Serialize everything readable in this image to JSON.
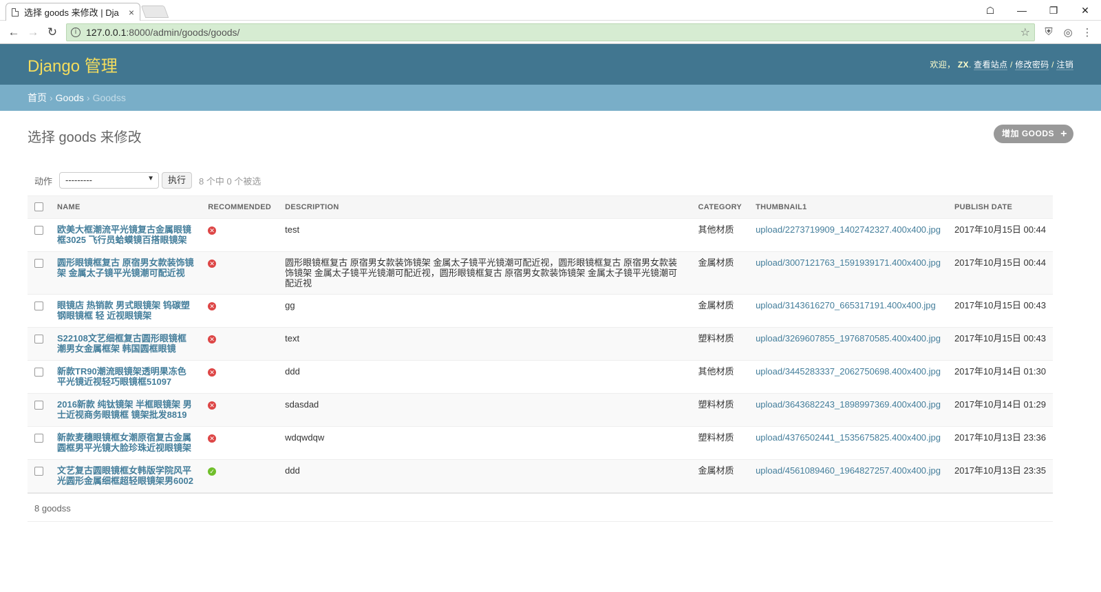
{
  "browser": {
    "tab_title": "选择 goods 来修改 | Dja",
    "tab_close": "×",
    "url_host": "127.0.0.1",
    "url_rest": ":8000/admin/goods/goods/",
    "controls": {
      "minimize": "—",
      "restore": "❐",
      "close": "✕",
      "back": "←",
      "forward": "→",
      "reload": "↻",
      "star": "☆",
      "menu": "⋮"
    }
  },
  "header": {
    "branding": "Django 管理",
    "welcome": "欢迎，",
    "username": "ZX",
    "period": ".",
    "view_site": "查看站点",
    "change_password": "修改密码",
    "logout": "注销",
    "sep": "/"
  },
  "breadcrumbs": {
    "home": "首页",
    "app": "Goods",
    "current": "Goodss",
    "sep": "›"
  },
  "page": {
    "title": "选择 goods 来修改",
    "add_button": "增加 GOODS",
    "plus": "+"
  },
  "actions": {
    "label": "动作",
    "selected_option": "---------",
    "go_button": "执行",
    "counter": "8 个中 0 个被选"
  },
  "table": {
    "headers": {
      "name": "NAME",
      "recommended": "RECOMMENDED",
      "description": "DESCRIPTION",
      "category": "CATEGORY",
      "thumbnail": "THUMBNAIL1",
      "publish_date": "PUBLISH DATE"
    },
    "rows": [
      {
        "name": "欧美大框潮流平光镜复古金属眼镜框3025 飞行员蛤蟆镜百搭眼镜架",
        "recommended": false,
        "description": "test",
        "category": "其他材质",
        "thumbnail": "upload/2273719909_1402742327.400x400.jpg",
        "date": "2017年10月15日 00:44"
      },
      {
        "name": "圆形眼镜框复古 原宿男女款装饰镜架 金属太子镜平光镜潮可配近视",
        "recommended": false,
        "description": "圆形眼镜框复古 原宿男女款装饰镜架 金属太子镜平光镜潮可配近视，圆形眼镜框复古 原宿男女款装饰镜架 金属太子镜平光镜潮可配近视，圆形眼镜框复古 原宿男女款装饰镜架 金属太子镜平光镜潮可配近视",
        "category": "金属材质",
        "thumbnail": "upload/3007121763_1591939171.400x400.jpg",
        "date": "2017年10月15日 00:44"
      },
      {
        "name": "眼镜店 热销款 男式眼镜架 钨碳塑钢眼镜框 轻 近视眼镜架",
        "recommended": false,
        "description": "gg",
        "category": "金属材质",
        "thumbnail": "upload/3143616270_665317191.400x400.jpg",
        "date": "2017年10月15日 00:43"
      },
      {
        "name": "S22108文艺细框复古圆形眼镜框 潮男女金属框架 韩国圆框眼镜",
        "recommended": false,
        "description": "text",
        "category": "塑料材质",
        "thumbnail": "upload/3269607855_1976870585.400x400.jpg",
        "date": "2017年10月15日 00:43"
      },
      {
        "name": "新款TR90潮流眼镜架透明果冻色平光镜近视轻巧眼镜框51097",
        "recommended": false,
        "description": "ddd",
        "category": "其他材质",
        "thumbnail": "upload/3445283337_2062750698.400x400.jpg",
        "date": "2017年10月14日 01:30"
      },
      {
        "name": "2016新款 纯钛镜架 半框眼镜架 男士近视商务眼镜框 镜架批发8819",
        "recommended": false,
        "description": "sdasdad",
        "category": "塑料材质",
        "thumbnail": "upload/3643682243_1898997369.400x400.jpg",
        "date": "2017年10月14日 01:29"
      },
      {
        "name": "新款麦穗眼镜框女潮原宿复古金属圆框男平光镜大脸珍珠近视眼镜架",
        "recommended": false,
        "description": "wdqwdqw",
        "category": "塑料材质",
        "thumbnail": "upload/4376502441_1535675825.400x400.jpg",
        "date": "2017年10月13日 23:36"
      },
      {
        "name": "文艺复古圆眼镜框女韩版学院风平光圆形金属细框超轻眼镜架男6002",
        "recommended": true,
        "description": "ddd",
        "category": "金属材质",
        "thumbnail": "upload/4561089460_1964827257.400x400.jpg",
        "date": "2017年10月13日 23:35"
      }
    ]
  },
  "paginator": "8 goodss",
  "colors": {
    "header": "#417690",
    "breadcrumbs": "#79aec8",
    "branding": "#f5dd5d",
    "link": "#447e9b",
    "no": "#dd4646",
    "yes": "#70bf2b"
  },
  "icons": {
    "no": "✕",
    "yes": "✓"
  }
}
